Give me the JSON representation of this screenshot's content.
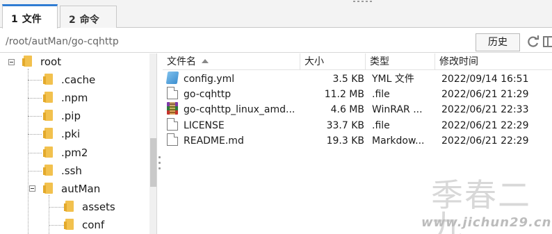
{
  "tabs": [
    {
      "num": "1",
      "label": "文件",
      "active": true
    },
    {
      "num": "2",
      "label": "命令",
      "active": false
    }
  ],
  "pathbar": {
    "path": "/root/autMan/go-cqhttp",
    "history_label": "历史",
    "refresh_icon": "refresh-icon",
    "extra_icon": "panel-icon"
  },
  "tree": {
    "root_label": "root",
    "items": [
      {
        "label": ".cache"
      },
      {
        "label": ".npm"
      },
      {
        "label": ".pip"
      },
      {
        "label": ".pki"
      },
      {
        "label": ".pm2"
      },
      {
        "label": ".ssh"
      },
      {
        "label": "autMan"
      },
      {
        "label": "assets"
      },
      {
        "label": "conf"
      }
    ]
  },
  "file_list": {
    "columns": {
      "name": "文件名",
      "size": "大小",
      "type": "类型",
      "modified": "修改时间"
    },
    "rows": [
      {
        "icon": "yml-file-icon",
        "name": "config.yml",
        "size": "3.5 KB",
        "type": "YML 文件",
        "modified": "2022/09/14 16:51"
      },
      {
        "icon": "file-icon",
        "name": "go-cqhttp",
        "size": "11.2 MB",
        "type": ".file",
        "modified": "2022/06/21 21:29"
      },
      {
        "icon": "rar-archive-icon",
        "name": "go-cqhttp_linux_amd...",
        "size": "4.6 MB",
        "type": "WinRAR ...",
        "modified": "2022/06/21 22:33"
      },
      {
        "icon": "file-icon",
        "name": "LICENSE",
        "size": "33.7 KB",
        "type": ".file",
        "modified": "2022/06/21 22:29"
      },
      {
        "icon": "file-icon",
        "name": "README.md",
        "size": "19.3 KB",
        "type": "Markdow...",
        "modified": "2022/06/21 22:29"
      }
    ]
  },
  "watermark": {
    "title": "季春二九",
    "url": "www.jichun29.cn"
  },
  "colors": {
    "tab_accent": "#2f7cd3",
    "folder": "#f2c14e"
  }
}
